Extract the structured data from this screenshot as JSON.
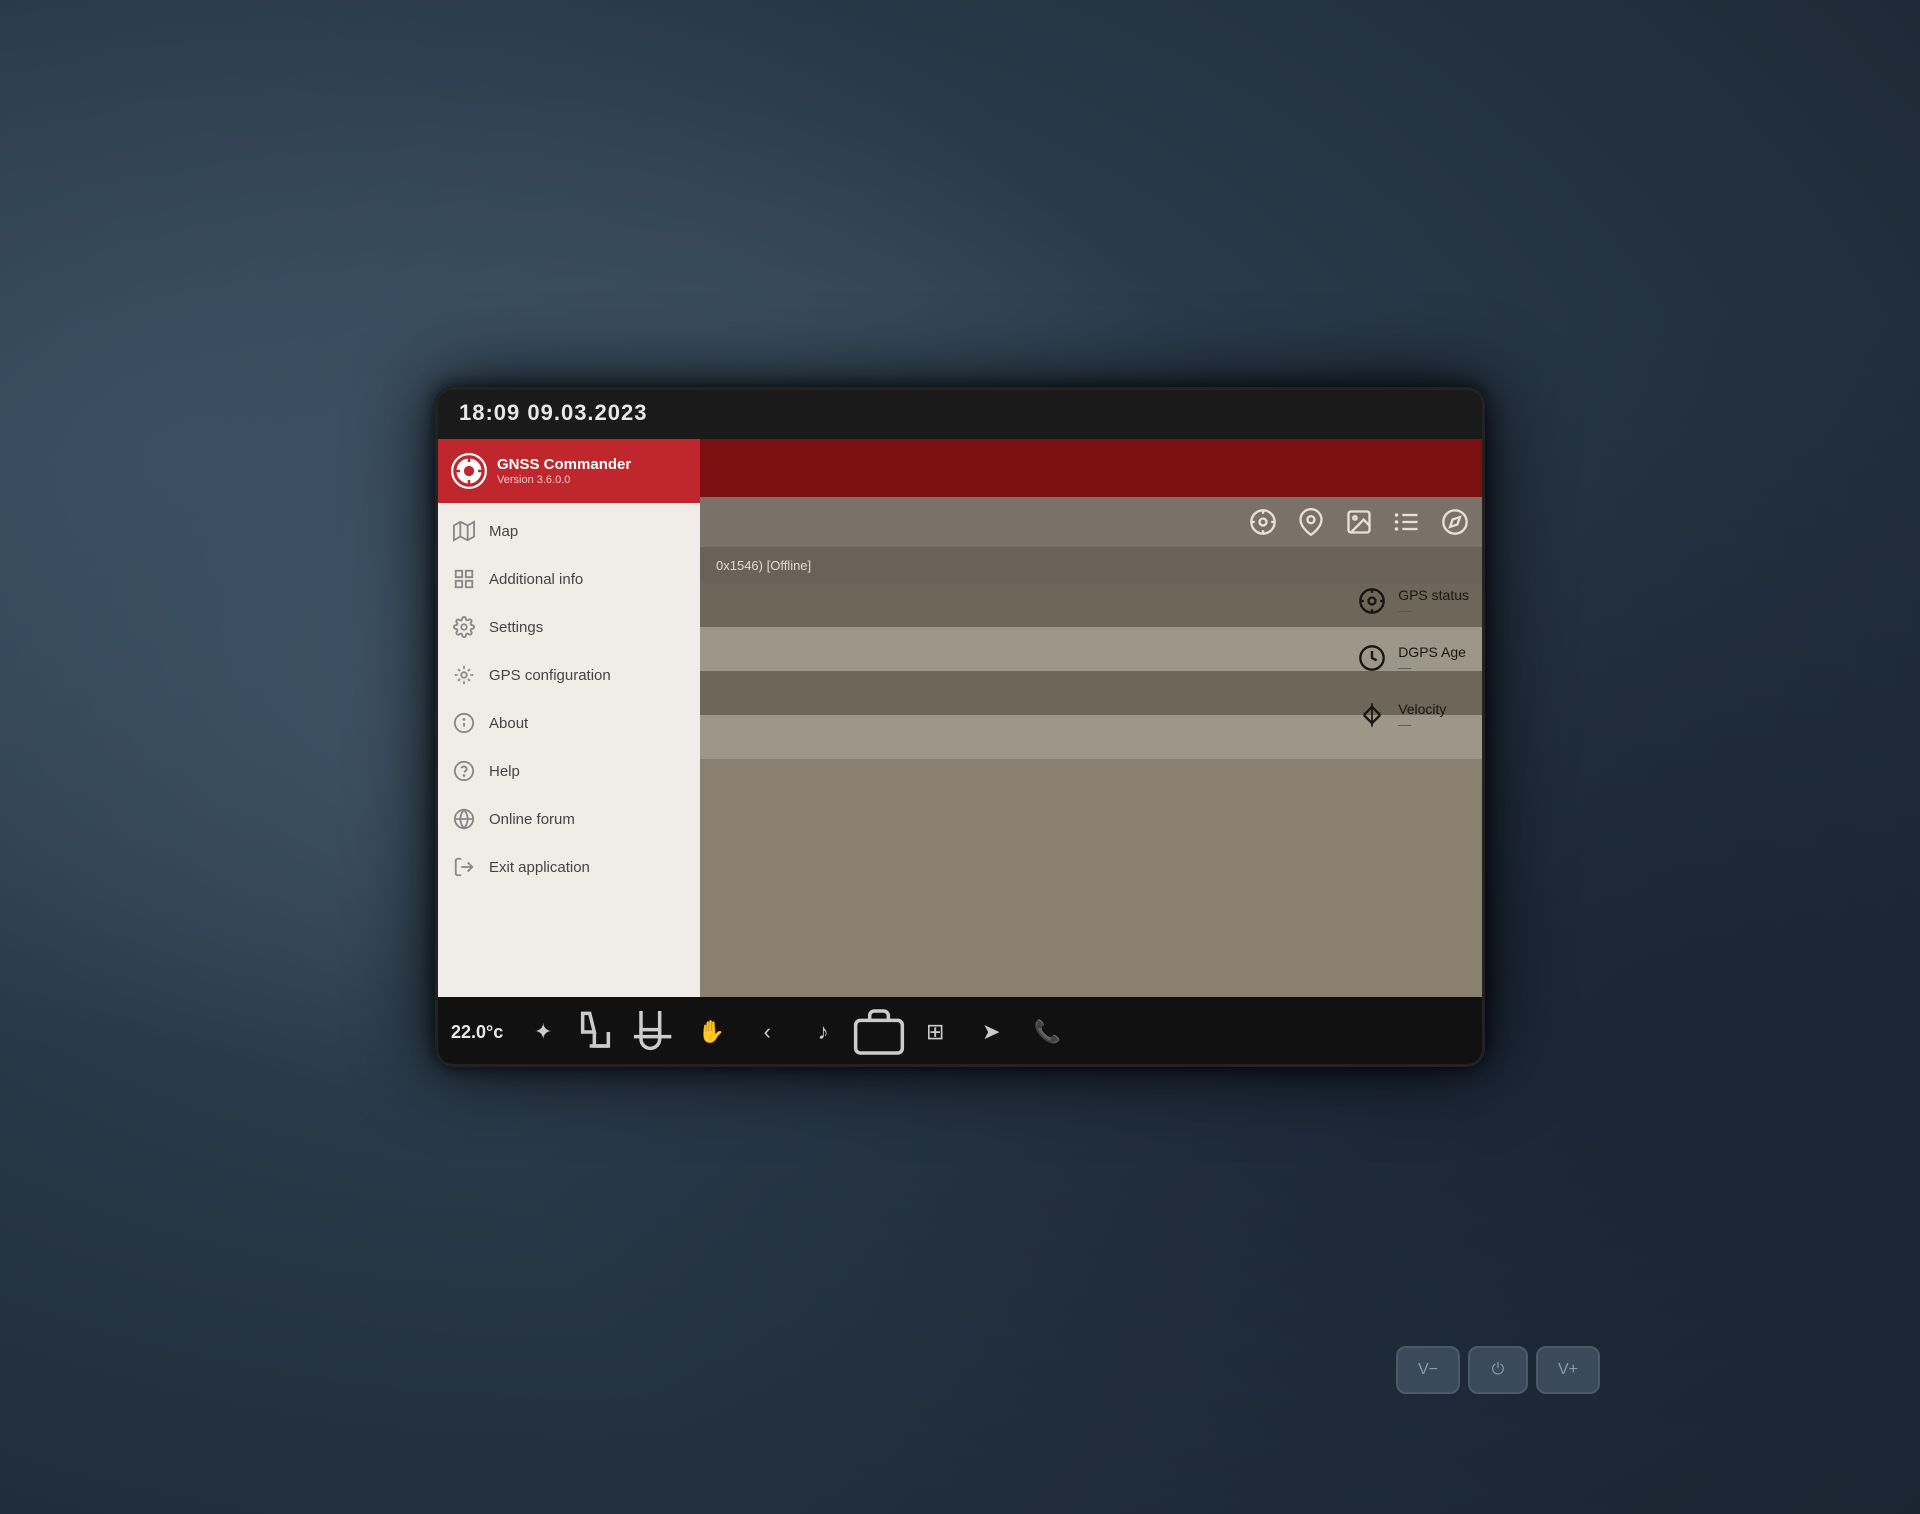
{
  "header": {
    "datetime": "18:09  09.03.2023"
  },
  "app": {
    "title": "GNSS Commander",
    "version": "Version 3.6.0.0"
  },
  "menu": {
    "items": [
      {
        "id": "map",
        "label": "Map",
        "icon": "map"
      },
      {
        "id": "additional-info",
        "label": "Additional info",
        "icon": "grid"
      },
      {
        "id": "settings",
        "label": "Settings",
        "icon": "gear"
      },
      {
        "id": "gps-configuration",
        "label": "GPS configuration",
        "icon": "gps-config"
      },
      {
        "id": "about",
        "label": "About",
        "icon": "info"
      },
      {
        "id": "help",
        "label": "Help",
        "icon": "help"
      },
      {
        "id": "online-forum",
        "label": "Online forum",
        "icon": "globe"
      },
      {
        "id": "exit-application",
        "label": "Exit application",
        "icon": "exit"
      }
    ]
  },
  "content": {
    "status": "0x1546) [Offline]",
    "gps_status_label": "GPS status",
    "gps_status_value": "—",
    "dgps_age_label": "DGPS Age",
    "dgps_age_value": "—",
    "velocity_label": "Velocity",
    "velocity_value": "—"
  },
  "taskbar": {
    "temperature": "22.0°c",
    "icons": [
      "fan",
      "seat",
      "heated-seat",
      "gesture",
      "back",
      "music",
      "briefcase",
      "grid",
      "navigation",
      "phone"
    ]
  },
  "physical_buttons": {
    "volume_down": "V−",
    "power": "⏻",
    "volume_up": "V+"
  },
  "colors": {
    "accent_red": "#c0272d",
    "sidebar_bg": "#f0ede8",
    "screen_bg": "#1a1a1a",
    "taskbar_bg": "#111111"
  }
}
